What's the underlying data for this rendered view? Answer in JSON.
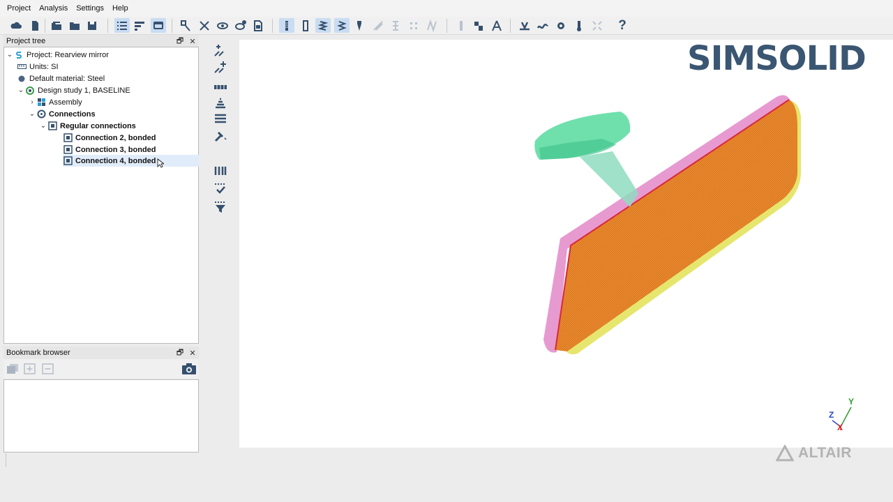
{
  "menu": [
    "Project",
    "Analysis",
    "Settings",
    "Help"
  ],
  "toolbar_icons": [
    "cloud-icon",
    "new-file-icon",
    "open-folder-icon",
    "folder-icon",
    "save-icon",
    "list-view-icon",
    "align-icon",
    "screen-icon",
    "part-select-icon",
    "explode-icon",
    "eye-icon",
    "eye-gear-icon",
    "document-icon",
    "bolt-icon",
    "frame-icon",
    "spring-icon",
    "spring-box-icon",
    "bolt-box-icon",
    "grid-icon",
    "weld-icon",
    "contact-icon",
    "measure-icon",
    "angle-icon",
    "load-icon",
    "wave-icon",
    "gear-load-icon",
    "thermo-icon",
    "fit-icon",
    "help-icon"
  ],
  "project_tree": {
    "title": "Project tree",
    "items": [
      {
        "label": "Project: Rearview mirror"
      },
      {
        "label": "Units: SI"
      },
      {
        "label": "Default material: Steel"
      },
      {
        "label": "Design study 1, BASELINE"
      },
      {
        "label": "Assembly"
      },
      {
        "label": "Connections"
      },
      {
        "label": "Regular connections"
      },
      {
        "label": "Connection 2, bonded"
      },
      {
        "label": "Connection 3, bonded"
      },
      {
        "label": "Connection 4, bonded"
      }
    ]
  },
  "bookmark_browser": {
    "title": "Bookmark browser"
  },
  "panel_buttons": {
    "float": "🗗",
    "close": "✕"
  },
  "viewport": {
    "brand": "SIMSOLID",
    "vendor": "ALTAIR",
    "axes": {
      "y": "Y",
      "z": "Z",
      "x": "X"
    },
    "colors": {
      "handle": "#6fe0ac",
      "frame_pink": "#e79ad0",
      "frame_yellow": "#e6e66f",
      "glass": "#e9892a",
      "edge_red": "#d8283a"
    }
  },
  "help_glyph": "?"
}
